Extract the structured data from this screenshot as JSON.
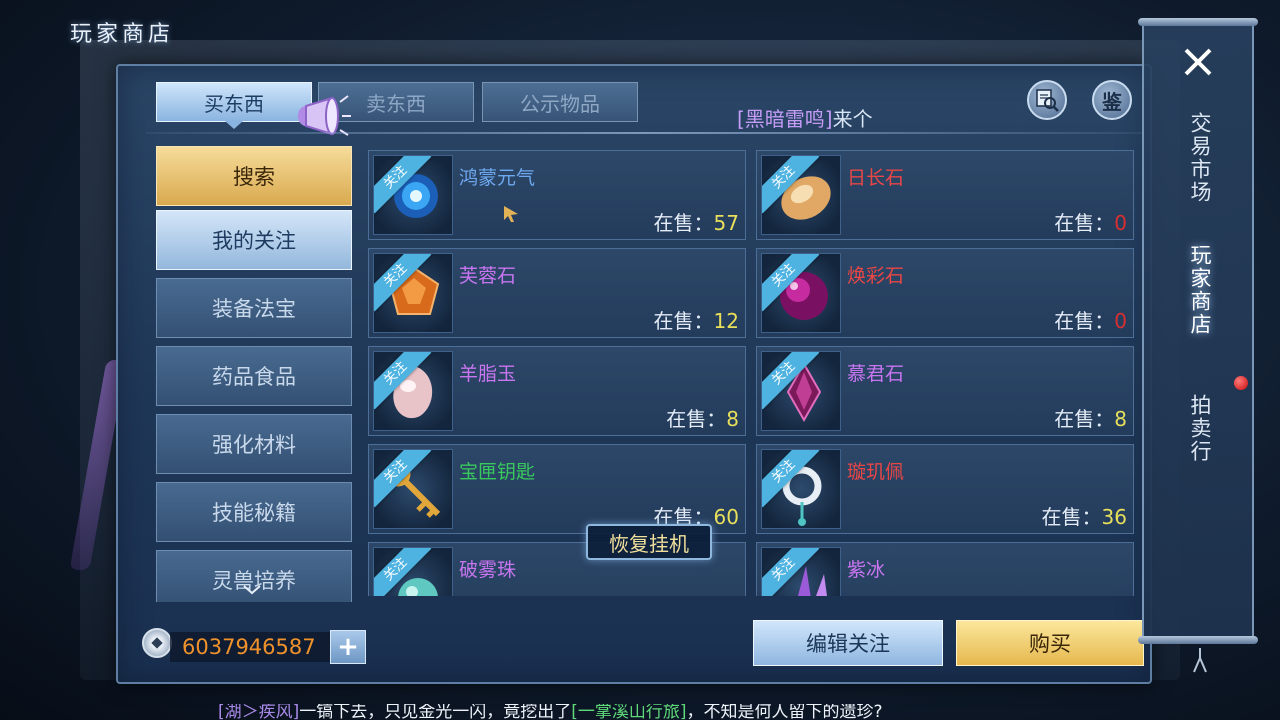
{
  "window": {
    "title": "玩家商店"
  },
  "tabs": {
    "buy": "买东西",
    "sell": "卖东西",
    "public": "公示物品"
  },
  "broadcast": {
    "user": "[黑暗雷鸣]",
    "text": "来个"
  },
  "buttons": {
    "appraise": "鉴",
    "restore_idle": "恢复挂机",
    "edit_watch": "编辑关注",
    "buy": "购买",
    "add_currency": "+"
  },
  "categories": [
    {
      "label": "搜索"
    },
    {
      "label": "我的关注"
    },
    {
      "label": "装备法宝"
    },
    {
      "label": "药品食品"
    },
    {
      "label": "强化材料"
    },
    {
      "label": "技能秘籍"
    },
    {
      "label": "灵兽培养"
    }
  ],
  "watch_tag": "关注",
  "stock_label": "在售：",
  "items": [
    {
      "name": "鸿蒙元气",
      "stock": "57",
      "name_color": "#6ea8ef",
      "in_stock": true,
      "icon": "blue-vortex-icon"
    },
    {
      "name": "日长石",
      "stock": "0",
      "name_color": "#e94646",
      "in_stock": false,
      "icon": "sunstone-icon"
    },
    {
      "name": "芙蓉石",
      "stock": "12",
      "name_color": "#c875f0",
      "in_stock": true,
      "icon": "orange-gem-icon"
    },
    {
      "name": "焕彩石",
      "stock": "0",
      "name_color": "#e94646",
      "in_stock": false,
      "icon": "purple-orb-icon"
    },
    {
      "name": "羊脂玉",
      "stock": "8",
      "name_color": "#c875f0",
      "in_stock": true,
      "icon": "white-jade-icon"
    },
    {
      "name": "慕君石",
      "stock": "8",
      "name_color": "#c875f0",
      "in_stock": true,
      "icon": "purple-crystal-icon"
    },
    {
      "name": "宝匣钥匙",
      "stock": "60",
      "name_color": "#38c95c",
      "in_stock": true,
      "icon": "golden-key-icon"
    },
    {
      "name": "璇玑佩",
      "stock": "36",
      "name_color": "#e94646",
      "in_stock": true,
      "icon": "jade-pendant-icon"
    },
    {
      "name": "破雾珠",
      "stock": "",
      "name_color": "#c875f0",
      "in_stock": true,
      "icon": "teal-pearl-icon"
    },
    {
      "name": "紫冰",
      "stock": "",
      "name_color": "#c875f0",
      "in_stock": true,
      "icon": "purple-ice-icon"
    }
  ],
  "currency": {
    "amount": "6037946587",
    "icon": "coin-icon"
  },
  "side_nav": [
    {
      "label": "交易市场"
    },
    {
      "label": "玩家商店"
    },
    {
      "label": "拍卖行"
    }
  ],
  "ticker": {
    "user": "[湖＞疾风]",
    "text1": "一镐下去，只见金光一闪，竟挖出了",
    "place": "[一掌溪山行旅]",
    "text2": "，不知是何人留下的遗珍?"
  },
  "colors": {
    "accent_gold": "#e6b84e",
    "accent_blue": "#8fb6e0",
    "stock_number": "#e8df5b",
    "stock_zero": "#d92f2f",
    "currency": "#f0922b",
    "watch_tag": "#4fb3e2"
  }
}
